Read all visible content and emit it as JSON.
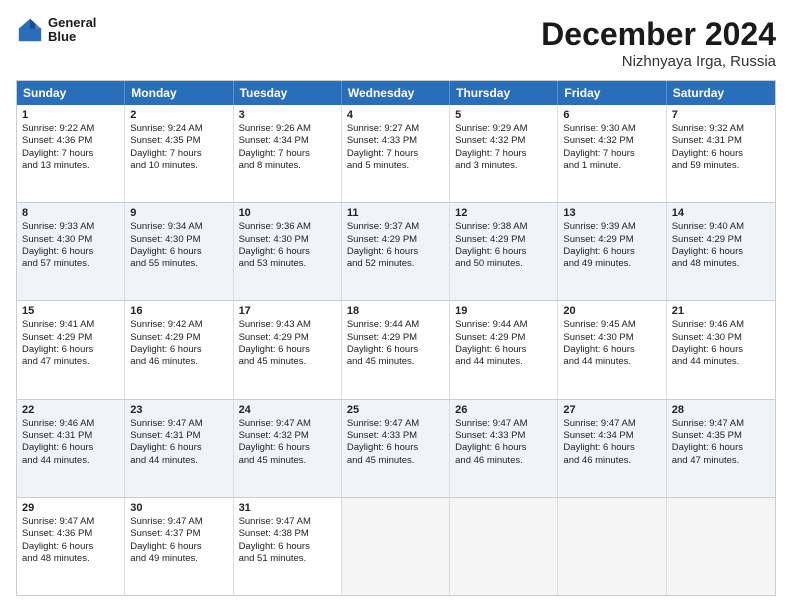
{
  "logo": {
    "line1": "General",
    "line2": "Blue"
  },
  "title": "December 2024",
  "subtitle": "Nizhnyaya Irga, Russia",
  "header_days": [
    "Sunday",
    "Monday",
    "Tuesday",
    "Wednesday",
    "Thursday",
    "Friday",
    "Saturday"
  ],
  "rows": [
    [
      {
        "day": "1",
        "lines": [
          "Sunrise: 9:22 AM",
          "Sunset: 4:36 PM",
          "Daylight: 7 hours",
          "and 13 minutes."
        ]
      },
      {
        "day": "2",
        "lines": [
          "Sunrise: 9:24 AM",
          "Sunset: 4:35 PM",
          "Daylight: 7 hours",
          "and 10 minutes."
        ]
      },
      {
        "day": "3",
        "lines": [
          "Sunrise: 9:26 AM",
          "Sunset: 4:34 PM",
          "Daylight: 7 hours",
          "and 8 minutes."
        ]
      },
      {
        "day": "4",
        "lines": [
          "Sunrise: 9:27 AM",
          "Sunset: 4:33 PM",
          "Daylight: 7 hours",
          "and 5 minutes."
        ]
      },
      {
        "day": "5",
        "lines": [
          "Sunrise: 9:29 AM",
          "Sunset: 4:32 PM",
          "Daylight: 7 hours",
          "and 3 minutes."
        ]
      },
      {
        "day": "6",
        "lines": [
          "Sunrise: 9:30 AM",
          "Sunset: 4:32 PM",
          "Daylight: 7 hours",
          "and 1 minute."
        ]
      },
      {
        "day": "7",
        "lines": [
          "Sunrise: 9:32 AM",
          "Sunset: 4:31 PM",
          "Daylight: 6 hours",
          "and 59 minutes."
        ]
      }
    ],
    [
      {
        "day": "8",
        "lines": [
          "Sunrise: 9:33 AM",
          "Sunset: 4:30 PM",
          "Daylight: 6 hours",
          "and 57 minutes."
        ]
      },
      {
        "day": "9",
        "lines": [
          "Sunrise: 9:34 AM",
          "Sunset: 4:30 PM",
          "Daylight: 6 hours",
          "and 55 minutes."
        ]
      },
      {
        "day": "10",
        "lines": [
          "Sunrise: 9:36 AM",
          "Sunset: 4:30 PM",
          "Daylight: 6 hours",
          "and 53 minutes."
        ]
      },
      {
        "day": "11",
        "lines": [
          "Sunrise: 9:37 AM",
          "Sunset: 4:29 PM",
          "Daylight: 6 hours",
          "and 52 minutes."
        ]
      },
      {
        "day": "12",
        "lines": [
          "Sunrise: 9:38 AM",
          "Sunset: 4:29 PM",
          "Daylight: 6 hours",
          "and 50 minutes."
        ]
      },
      {
        "day": "13",
        "lines": [
          "Sunrise: 9:39 AM",
          "Sunset: 4:29 PM",
          "Daylight: 6 hours",
          "and 49 minutes."
        ]
      },
      {
        "day": "14",
        "lines": [
          "Sunrise: 9:40 AM",
          "Sunset: 4:29 PM",
          "Daylight: 6 hours",
          "and 48 minutes."
        ]
      }
    ],
    [
      {
        "day": "15",
        "lines": [
          "Sunrise: 9:41 AM",
          "Sunset: 4:29 PM",
          "Daylight: 6 hours",
          "and 47 minutes."
        ]
      },
      {
        "day": "16",
        "lines": [
          "Sunrise: 9:42 AM",
          "Sunset: 4:29 PM",
          "Daylight: 6 hours",
          "and 46 minutes."
        ]
      },
      {
        "day": "17",
        "lines": [
          "Sunrise: 9:43 AM",
          "Sunset: 4:29 PM",
          "Daylight: 6 hours",
          "and 45 minutes."
        ]
      },
      {
        "day": "18",
        "lines": [
          "Sunrise: 9:44 AM",
          "Sunset: 4:29 PM",
          "Daylight: 6 hours",
          "and 45 minutes."
        ]
      },
      {
        "day": "19",
        "lines": [
          "Sunrise: 9:44 AM",
          "Sunset: 4:29 PM",
          "Daylight: 6 hours",
          "and 44 minutes."
        ]
      },
      {
        "day": "20",
        "lines": [
          "Sunrise: 9:45 AM",
          "Sunset: 4:30 PM",
          "Daylight: 6 hours",
          "and 44 minutes."
        ]
      },
      {
        "day": "21",
        "lines": [
          "Sunrise: 9:46 AM",
          "Sunset: 4:30 PM",
          "Daylight: 6 hours",
          "and 44 minutes."
        ]
      }
    ],
    [
      {
        "day": "22",
        "lines": [
          "Sunrise: 9:46 AM",
          "Sunset: 4:31 PM",
          "Daylight: 6 hours",
          "and 44 minutes."
        ]
      },
      {
        "day": "23",
        "lines": [
          "Sunrise: 9:47 AM",
          "Sunset: 4:31 PM",
          "Daylight: 6 hours",
          "and 44 minutes."
        ]
      },
      {
        "day": "24",
        "lines": [
          "Sunrise: 9:47 AM",
          "Sunset: 4:32 PM",
          "Daylight: 6 hours",
          "and 45 minutes."
        ]
      },
      {
        "day": "25",
        "lines": [
          "Sunrise: 9:47 AM",
          "Sunset: 4:33 PM",
          "Daylight: 6 hours",
          "and 45 minutes."
        ]
      },
      {
        "day": "26",
        "lines": [
          "Sunrise: 9:47 AM",
          "Sunset: 4:33 PM",
          "Daylight: 6 hours",
          "and 46 minutes."
        ]
      },
      {
        "day": "27",
        "lines": [
          "Sunrise: 9:47 AM",
          "Sunset: 4:34 PM",
          "Daylight: 6 hours",
          "and 46 minutes."
        ]
      },
      {
        "day": "28",
        "lines": [
          "Sunrise: 9:47 AM",
          "Sunset: 4:35 PM",
          "Daylight: 6 hours",
          "and 47 minutes."
        ]
      }
    ],
    [
      {
        "day": "29",
        "lines": [
          "Sunrise: 9:47 AM",
          "Sunset: 4:36 PM",
          "Daylight: 6 hours",
          "and 48 minutes."
        ]
      },
      {
        "day": "30",
        "lines": [
          "Sunrise: 9:47 AM",
          "Sunset: 4:37 PM",
          "Daylight: 6 hours",
          "and 49 minutes."
        ]
      },
      {
        "day": "31",
        "lines": [
          "Sunrise: 9:47 AM",
          "Sunset: 4:38 PM",
          "Daylight: 6 hours",
          "and 51 minutes."
        ]
      },
      null,
      null,
      null,
      null
    ]
  ]
}
